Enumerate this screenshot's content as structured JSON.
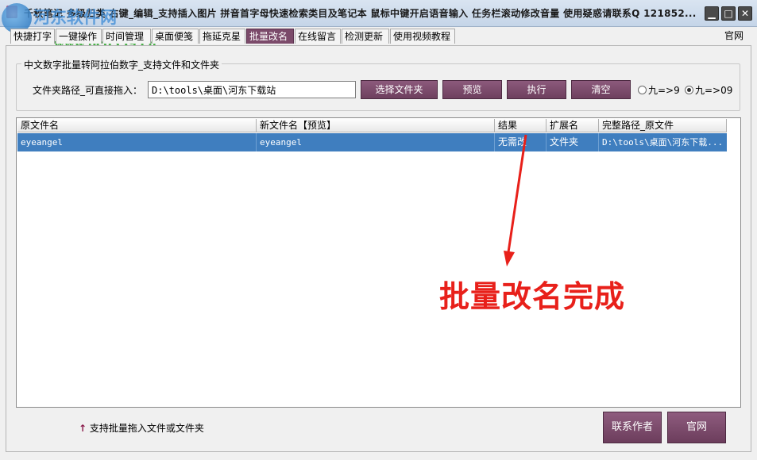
{
  "window": {
    "title": "千秋笔记  多级归类  右键_编辑_支持插入图片   拼音首字母快速检索类目及笔记本   鼠标中键开启语音输入   任务栏滚动修改音量   使用疑惑请联系Q  121852...",
    "minimize": "▁",
    "maximize": "□",
    "close": "✕"
  },
  "watermark": {
    "brand": "河东软件网",
    "url": "www.pc0359.cn"
  },
  "tabs": [
    {
      "label": "快捷打字"
    },
    {
      "label": "一键操作"
    },
    {
      "label": "时间管理"
    },
    {
      "label": "桌面便笺"
    },
    {
      "label": "拖延克星"
    },
    {
      "label": "批量改名",
      "active": true
    },
    {
      "label": "在线留言"
    },
    {
      "label": "检测更新"
    },
    {
      "label": "使用视频教程"
    }
  ],
  "official_link": "官网",
  "group": {
    "title": "中文数字批量转阿拉伯数字_支持文件和文件夹",
    "path_label": "文件夹路径_可直接拖入：",
    "path_value": "D:\\tools\\桌面\\河东下载站",
    "buttons": {
      "select_folder": "选择文件夹",
      "preview": "预览",
      "execute": "执行",
      "clear": "清空"
    },
    "radios": [
      {
        "label": "九=>9",
        "checked": false
      },
      {
        "label": "九=>09",
        "checked": true
      }
    ]
  },
  "table": {
    "columns": [
      "原文件名",
      "新文件名【预览】",
      "结果",
      "扩展名",
      "完整路径_原文件"
    ],
    "rows": [
      [
        "eyeangel",
        "eyeangel",
        "无需改",
        "文件夹",
        "D:\\tools\\桌面\\河东下载..."
      ]
    ]
  },
  "annotation": {
    "text": "批量改名完成",
    "color": "#e8201a"
  },
  "bottom": {
    "hint_arrow": "↑",
    "hint": "支持批量拖入文件或文件夹",
    "contact_author": "联系作者",
    "official": "官网"
  },
  "colors": {
    "accent": "#7b4a6a",
    "selection": "#3f7ebf"
  }
}
